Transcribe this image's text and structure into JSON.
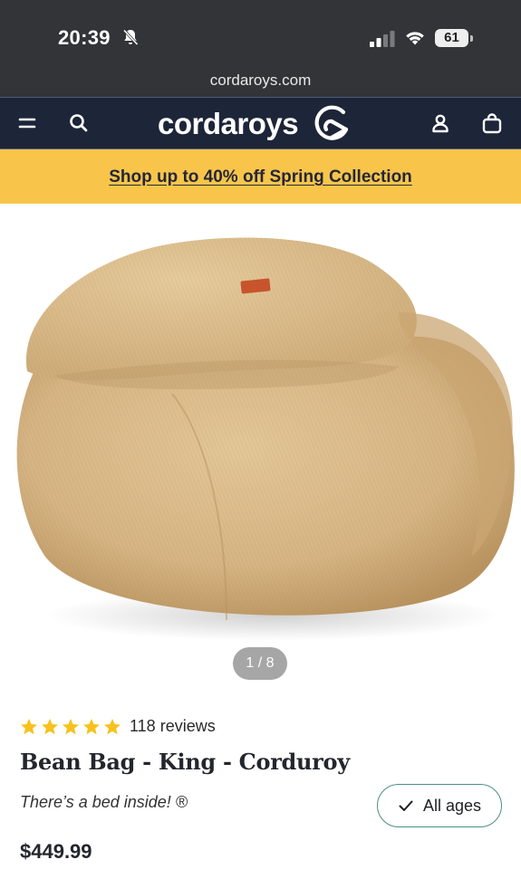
{
  "status_bar": {
    "time": "20:39",
    "battery": "61"
  },
  "browser": {
    "url": "cordaroys.com"
  },
  "site_nav": {
    "logo_text": "cordaroys"
  },
  "promo": {
    "text": "Shop up to 40% off Spring Collection"
  },
  "gallery": {
    "counter": "1 / 8"
  },
  "product": {
    "rating_stars": 5,
    "reviews": "118 reviews",
    "title": "Bean Bag - King - Corduroy",
    "tagline": "There’s a bed inside! ®",
    "ages_label": "All ages",
    "price": "$449.99"
  },
  "colors": {
    "nav_bg": "#1d2538",
    "promo_bg": "#f8c54a",
    "star": "#f7c21c",
    "fabric": "#d8b98a"
  }
}
